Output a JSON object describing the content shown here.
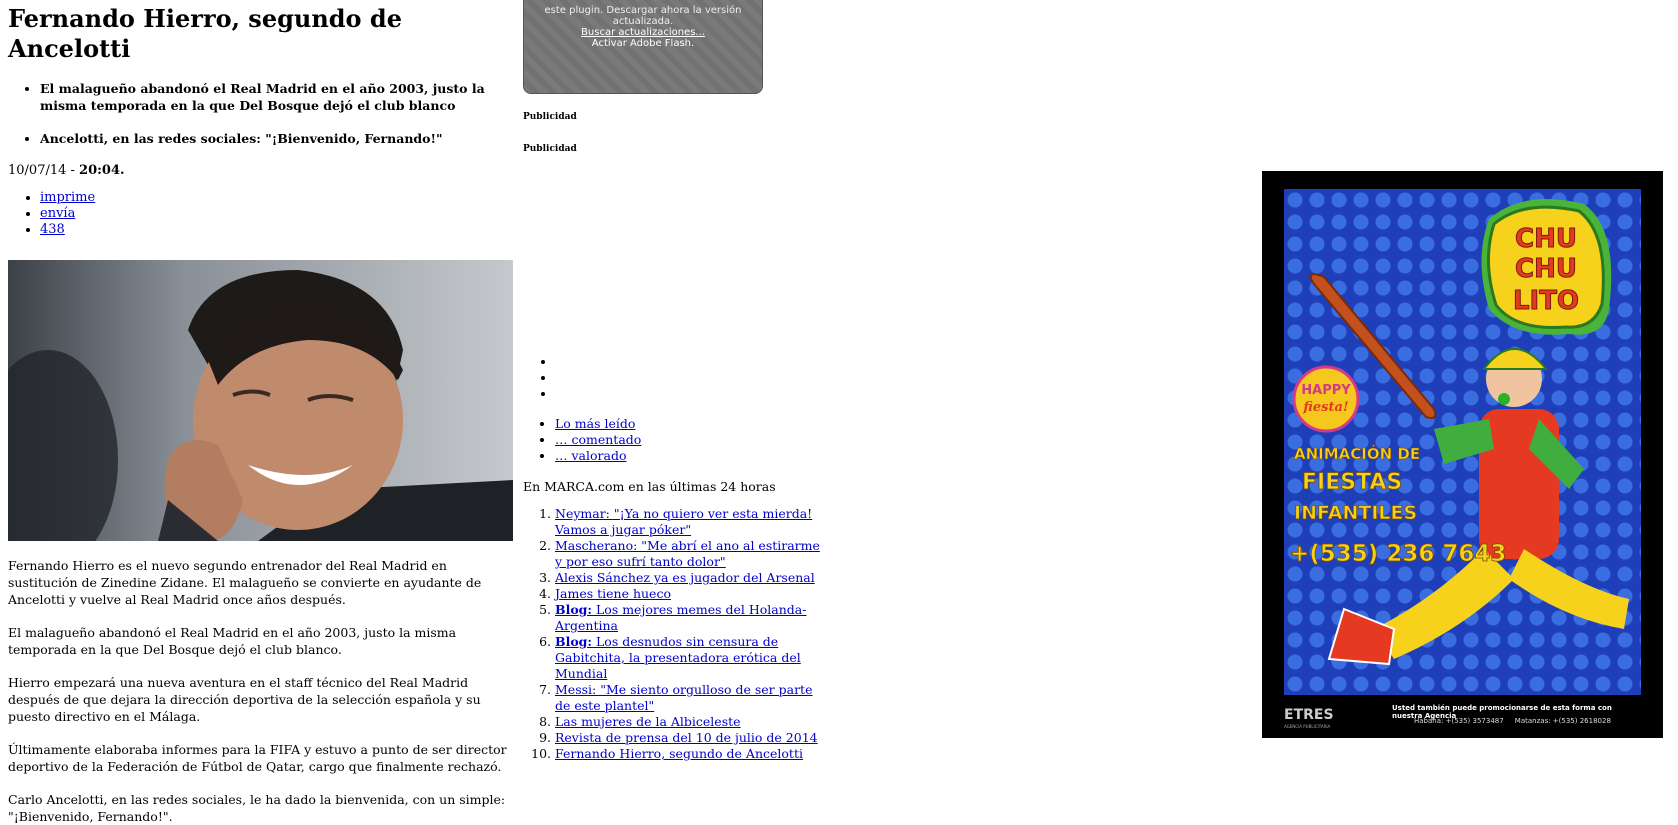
{
  "article": {
    "title": "Fernando Hierro, segundo de Ancelotti",
    "subheads": [
      "El malagueño abandonó el Real Madrid en el año 2003, justo la misma temporada en la que Del Bosque dejó el club blanco",
      "Ancelotti, en las redes sociales: \"¡Bienvenido, Fernando!\""
    ],
    "date": "10/07/14 - ",
    "time": "20:04.",
    "tools": [
      "imprime",
      "envía",
      "438"
    ],
    "paragraphs": [
      "Fernando Hierro es el nuevo segundo entrenador del Real Madrid en sustitución de Zinedine Zidane. El malagueño se convierte en ayudante de Ancelotti y vuelve al Real Madrid once años después.",
      "El malagueño abandonó el Real Madrid en el año 2003, justo la misma temporada en la que Del Bosque dejó el club blanco.",
      "Hierro empezará una nueva aventura en el staff técnico del Real Madrid después de que dejara la dirección deportiva de la selección española y su puesto directivo en el Málaga.",
      "Últimamente elaboraba informes para la FIFA y estuvo a punto de ser director deportivo de la Federación de Fútbol de Qatar, cargo que finalmente rechazó.",
      "Carlo Ancelotti, en las redes sociales, le ha dado la bienvenida, con un simple: \"¡Bienvenido, Fernando!\"."
    ]
  },
  "flash": {
    "top_line": "este plugin. Descargar ahora la versión actualizada.",
    "update_link": "Buscar actualizaciones...",
    "activate": "Activar Adobe Flash."
  },
  "ads": {
    "label1": "Publicidad",
    "label2": "Publicidad"
  },
  "tabs": [
    "Lo más leído",
    "… comentado",
    "… valorado"
  ],
  "last24": "En MARCA.com en las últimas 24 horas",
  "ranking": [
    {
      "prefix": "",
      "text": "Neymar: \"¡Ya no quiero ver esta mierda! Vamos a jugar póker\""
    },
    {
      "prefix": "",
      "text": "Mascherano: \"Me abrí el ano al estirarme y por eso sufrí tanto dolor\""
    },
    {
      "prefix": "",
      "text": "Alexis Sánchez ya es jugador del Arsenal"
    },
    {
      "prefix": "",
      "text": "James tiene hueco"
    },
    {
      "prefix": "Blog:",
      "text": " Los mejores memes del Holanda-Argentina"
    },
    {
      "prefix": "Blog:",
      "text": " Los desnudos sin censura de Gabitchita, la presentadora erótica del Mundial"
    },
    {
      "prefix": "",
      "text": "Messi: \"Me siento orgulloso de ser parte de este plantel\""
    },
    {
      "prefix": "",
      "text": "Las mujeres de la Albiceleste"
    },
    {
      "prefix": "",
      "text": "Revista de prensa del 10 de julio de 2014"
    },
    {
      "prefix": "",
      "text": "Fernando Hierro, segundo de Ancelotti"
    }
  ],
  "ad_banner": {
    "brand": "CHU CHU LITO",
    "badge": "HAPPY fiesta!",
    "line1": "ANIMACIÓN DE",
    "line2": "FIESTAS",
    "line3": "INFANTILES",
    "phone": "+(535) 236 7643",
    "agency_logo": "ETRES",
    "agency_sub": "AGENCIA PUBLICITARIA",
    "footer1": "Usted también puede promocionarse de esta forma con nuestra Agencia",
    "footer2": "Habana: +(535) 3573487     Matanzas: +(535) 2618028",
    "colors": {
      "bg": "#1e3fb8",
      "dots": "#3a6ee0",
      "text": "#ffd400",
      "logo": "#f6d21c"
    }
  }
}
